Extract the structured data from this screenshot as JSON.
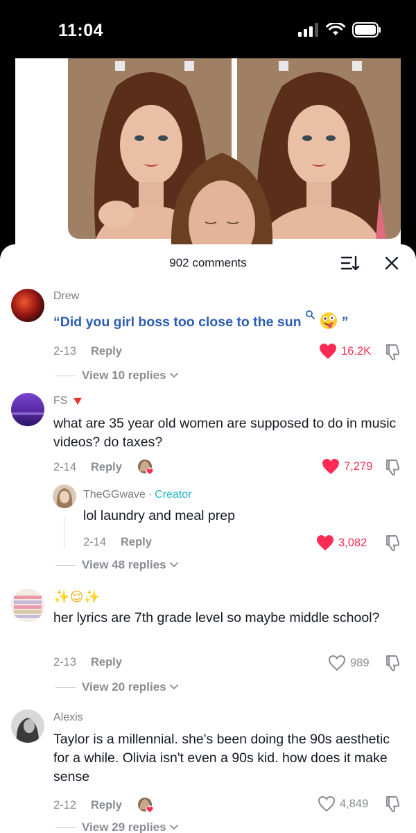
{
  "status_bar": {
    "time": "11:04"
  },
  "comments_header": {
    "count_label": "902 comments"
  },
  "comments": [
    {
      "username": "Drew",
      "text_quote_open": "“",
      "text_highlight": "Did you girl boss too close to the sun",
      "text_quote_close": "”",
      "date": "2-13",
      "reply_label": "Reply",
      "likes": "16.2K",
      "liked": true,
      "view_replies": "View 10 replies"
    },
    {
      "username": "FS",
      "text": "what are 35 year old women are supposed to do in music videos? do taxes?",
      "date": "2-14",
      "reply_label": "Reply",
      "likes": "7,279",
      "liked": true,
      "creator_liked": true
    },
    {
      "username": "TheGGwave",
      "creator_separator": "·",
      "creator_label": "Creator",
      "text": "lol laundry and meal prep",
      "date": "2-14",
      "reply_label": "Reply",
      "likes": "3,082",
      "liked": true,
      "view_replies": "View 48 replies"
    },
    {
      "username": "✨😌✨",
      "text": "her lyrics are 7th grade level so maybe middle school?",
      "date": "2-13",
      "reply_label": "Reply",
      "likes": "989",
      "liked": false,
      "view_replies": "View 20 replies"
    },
    {
      "username": "Alexis",
      "text": "Taylor is a millennial. she's been doing the 90s aesthetic for a while. Olivia isn't even a 90s kid. how does it make sense",
      "date": "2-12",
      "reply_label": "Reply",
      "likes": "4,849",
      "liked": false,
      "creator_liked": true,
      "view_replies": "View 29 replies"
    }
  ],
  "colors": {
    "like_red": "#fe2c55",
    "creator_teal": "#20b7c9",
    "highlight_blue": "#2b5db3"
  }
}
